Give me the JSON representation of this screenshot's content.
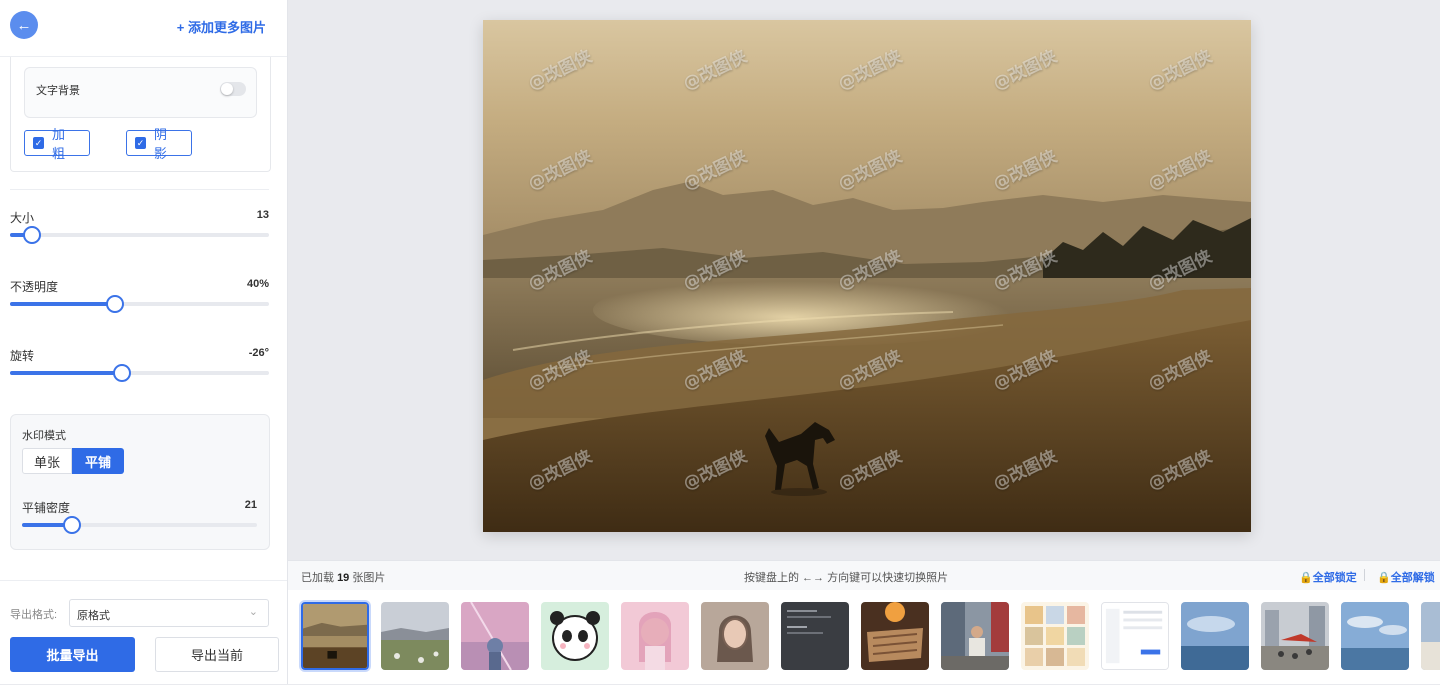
{
  "header": {
    "back_icon": "arrow-left-icon",
    "add_more": "+ 添加更多图片"
  },
  "text_style": {
    "bg_label": "文字背景",
    "bg_enabled": false,
    "bold": {
      "label": "加粗",
      "checked": true
    },
    "shadow": {
      "label": "阴影",
      "checked": true
    }
  },
  "sliders": {
    "size": {
      "label": "大小",
      "value": "13",
      "fraction": 0.08
    },
    "opacity": {
      "label": "不透明度",
      "value": "40%",
      "fraction": 0.4
    },
    "rotation": {
      "label": "旋转",
      "value": "-26°",
      "fraction": 0.43
    }
  },
  "mode": {
    "title": "水印模式",
    "single": "单张",
    "tile": "平铺",
    "selected": "平铺",
    "density": {
      "label": "平铺密度",
      "value": "21",
      "fraction": 0.21
    }
  },
  "export": {
    "format_label": "导出格式:",
    "format_value": "原格式",
    "batch_label": "批量导出",
    "current_label": "导出当前"
  },
  "preview": {
    "watermark_text": "@改图侠"
  },
  "strip": {
    "loaded_prefix": "已加载 ",
    "loaded_count": "19",
    "loaded_suffix": " 张图片",
    "hint": "按键盘上的 ←→ 方向键可以快速切换照片",
    "lock_all": "全部锁定",
    "unlock_all": "全部解锁"
  },
  "colors": {
    "accent": "#2f6be6",
    "back_button": "#5b8dee"
  }
}
